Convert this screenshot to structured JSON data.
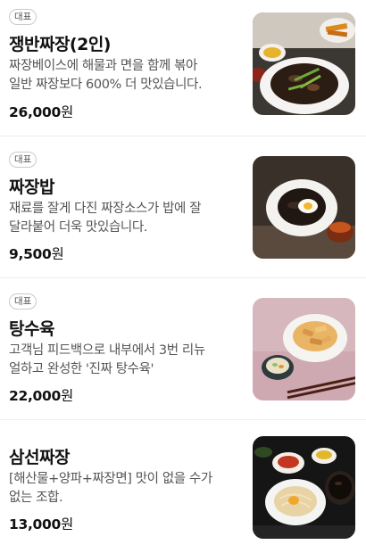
{
  "menu": {
    "items": [
      {
        "badge": "대표",
        "name": "쟁반짜장(2인)",
        "desc_line1": "짜장베이스에 해물과 면을 함께 볶아",
        "desc_line2": "일반 짜장보다 600% 더 맛있습니다.",
        "price": "26,000",
        "currency": "원",
        "image": "jjajang-platter-photo"
      },
      {
        "badge": "대표",
        "name": "짜장밥",
        "desc_line1": "재료를 잘게 다진 짜장소스가 밥에 잘",
        "desc_line2": "달라붙어 더욱 맛있습니다.",
        "price": "9,500",
        "currency": "원",
        "image": "jjajang-rice-photo"
      },
      {
        "badge": "대표",
        "name": "탕수육",
        "desc_line1": "고객님 피드백으로 내부에서 3번 리뉴",
        "desc_line2": "얼하고 완성한 '진짜 탕수육'",
        "price": "22,000",
        "currency": "원",
        "image": "tangsuyuk-photo"
      },
      {
        "badge": "",
        "name": "삼선짜장",
        "desc_line1": "[해산물+양파+짜장면] 맛이 없을 수가",
        "desc_line2": "없는 조합.",
        "price": "13,000",
        "currency": "원",
        "image": "samseon-jjajang-photo"
      }
    ]
  }
}
